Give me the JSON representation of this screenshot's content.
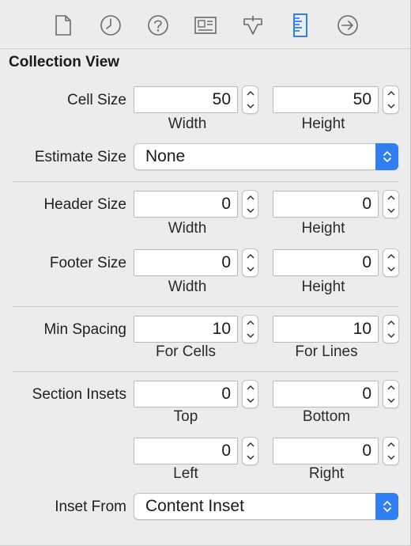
{
  "toolbar": {
    "tabs": [
      {
        "icon": "file-icon",
        "selected": false
      },
      {
        "icon": "clock-icon",
        "selected": false
      },
      {
        "icon": "help-icon",
        "selected": false
      },
      {
        "icon": "identity-card-icon",
        "selected": false
      },
      {
        "icon": "attributes-icon",
        "selected": false
      },
      {
        "icon": "ruler-icon",
        "selected": true
      },
      {
        "icon": "arrow-circle-icon",
        "selected": false
      }
    ],
    "accent": "#2f7ef6"
  },
  "section": {
    "title": "Collection View"
  },
  "cell_size": {
    "label": "Cell Size",
    "width": {
      "value": "50",
      "label": "Width"
    },
    "height": {
      "value": "50",
      "label": "Height"
    }
  },
  "estimate_size": {
    "label": "Estimate Size",
    "value": "None"
  },
  "header_size": {
    "label": "Header Size",
    "width": {
      "value": "0",
      "label": "Width"
    },
    "height": {
      "value": "0",
      "label": "Height"
    }
  },
  "footer_size": {
    "label": "Footer Size",
    "width": {
      "value": "0",
      "label": "Width"
    },
    "height": {
      "value": "0",
      "label": "Height"
    }
  },
  "min_spacing": {
    "label": "Min Spacing",
    "cells": {
      "value": "10",
      "label": "For Cells"
    },
    "lines": {
      "value": "10",
      "label": "For Lines"
    }
  },
  "section_insets": {
    "label": "Section Insets",
    "top": {
      "value": "0",
      "label": "Top"
    },
    "bottom": {
      "value": "0",
      "label": "Bottom"
    },
    "left": {
      "value": "0",
      "label": "Left"
    },
    "right": {
      "value": "0",
      "label": "Right"
    }
  },
  "inset_from": {
    "label": "Inset From",
    "value": "Content Inset"
  }
}
